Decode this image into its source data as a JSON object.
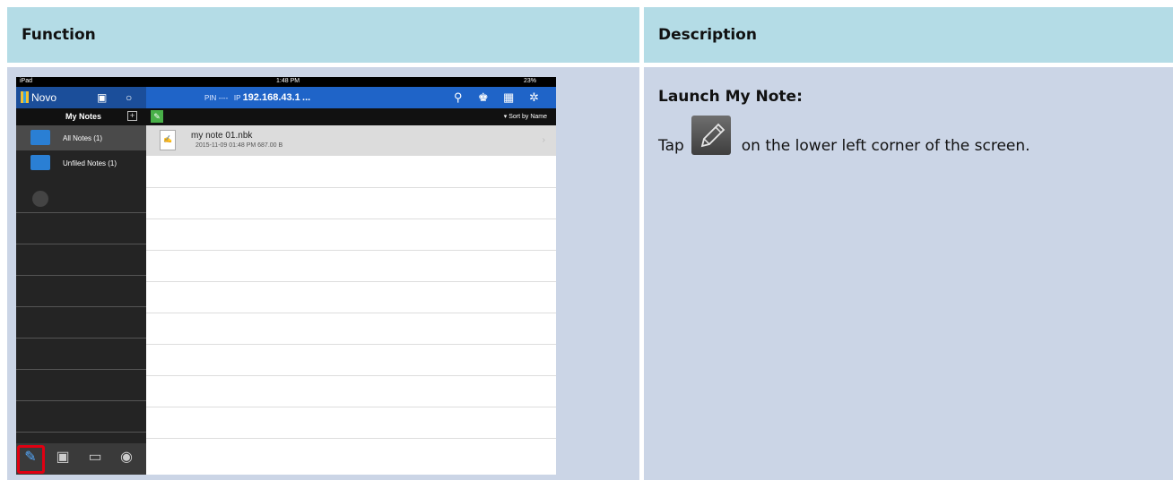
{
  "table": {
    "header_function": "Function",
    "header_description": "Description",
    "description_title": "Launch My Note:",
    "description_before_icon": "Tap",
    "description_after_icon": "on the lower left corner of the screen."
  },
  "ipad": {
    "status": {
      "left": "iPad",
      "time": "1:48 PM",
      "battery": "23%"
    },
    "app_name": "Novo",
    "pin_label": "PIN",
    "pin_value": "----",
    "ip_label": "IP",
    "ip_value": "192.168.43.1",
    "ip_more": "...",
    "sidebar_title": "My Notes",
    "plus_symbol": "+",
    "folders": [
      {
        "label": "All Notes (1)",
        "selected": true
      },
      {
        "label": "Unfiled Notes (1)",
        "selected": false
      }
    ],
    "sort_label": "Sort by Name",
    "note": {
      "name": "my note 01.nbk",
      "meta": "2015-11-09 01:48 PM  687.00 B"
    },
    "icons": [
      "pencil-icon",
      "image-icon",
      "folder-icon",
      "globe-icon",
      "link-icon",
      "presenter-icon",
      "grid-icon",
      "gear-icon",
      "screen-icon",
      "refresh-icon",
      "edit-icon"
    ]
  },
  "colors": {
    "header_bg": "#b4dce6",
    "body_bg": "#cbd5e6",
    "nav_blue": "#1f64c8",
    "highlight_red": "#e00012"
  }
}
